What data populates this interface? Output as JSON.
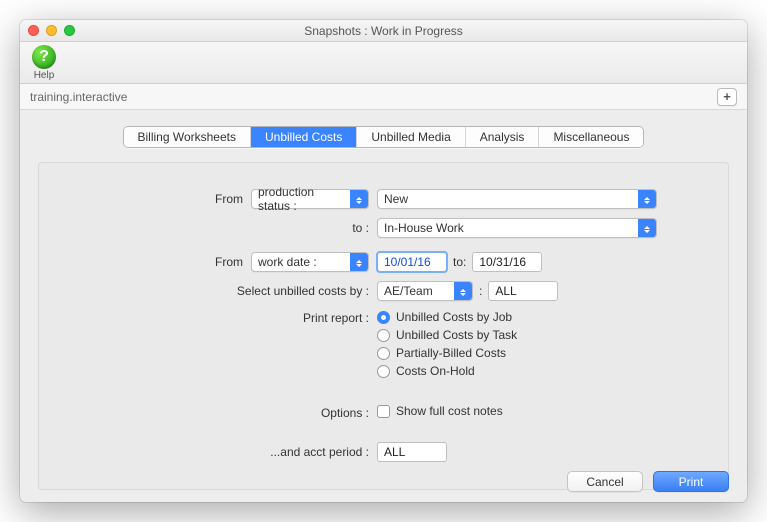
{
  "window": {
    "title": "Snapshots : Work in Progress"
  },
  "toolbar": {
    "help_label": "Help"
  },
  "subheader": {
    "context": "training.interactive"
  },
  "tabs": {
    "items": [
      {
        "label": "Billing Worksheets"
      },
      {
        "label": "Unbilled Costs"
      },
      {
        "label": "Unbilled Media"
      },
      {
        "label": "Analysis"
      },
      {
        "label": "Miscellaneous"
      }
    ],
    "active_index": 1
  },
  "form": {
    "from_label": "From",
    "from_field": "production status :",
    "status_from": "New",
    "to_label": "to :",
    "status_to": "In-House Work",
    "from2_label": "From",
    "from2_field": "work date :",
    "date_from": "10/01/16",
    "date_to_label": "to:",
    "date_to": "10/31/16",
    "costs_by_label": "Select unbilled costs by :",
    "costs_by_field": "AE/Team",
    "costs_by_sep": ":",
    "costs_by_value": "ALL",
    "print_label": "Print report :",
    "print_options": [
      "Unbilled Costs by Job",
      "Unbilled Costs by Task",
      "Partially-Billed Costs",
      "Costs On-Hold"
    ],
    "options_label": "Options :",
    "option_checkbox": "Show full cost notes",
    "acct_label": "...and acct period :",
    "acct_value": "ALL"
  },
  "footer": {
    "cancel": "Cancel",
    "print": "Print"
  }
}
